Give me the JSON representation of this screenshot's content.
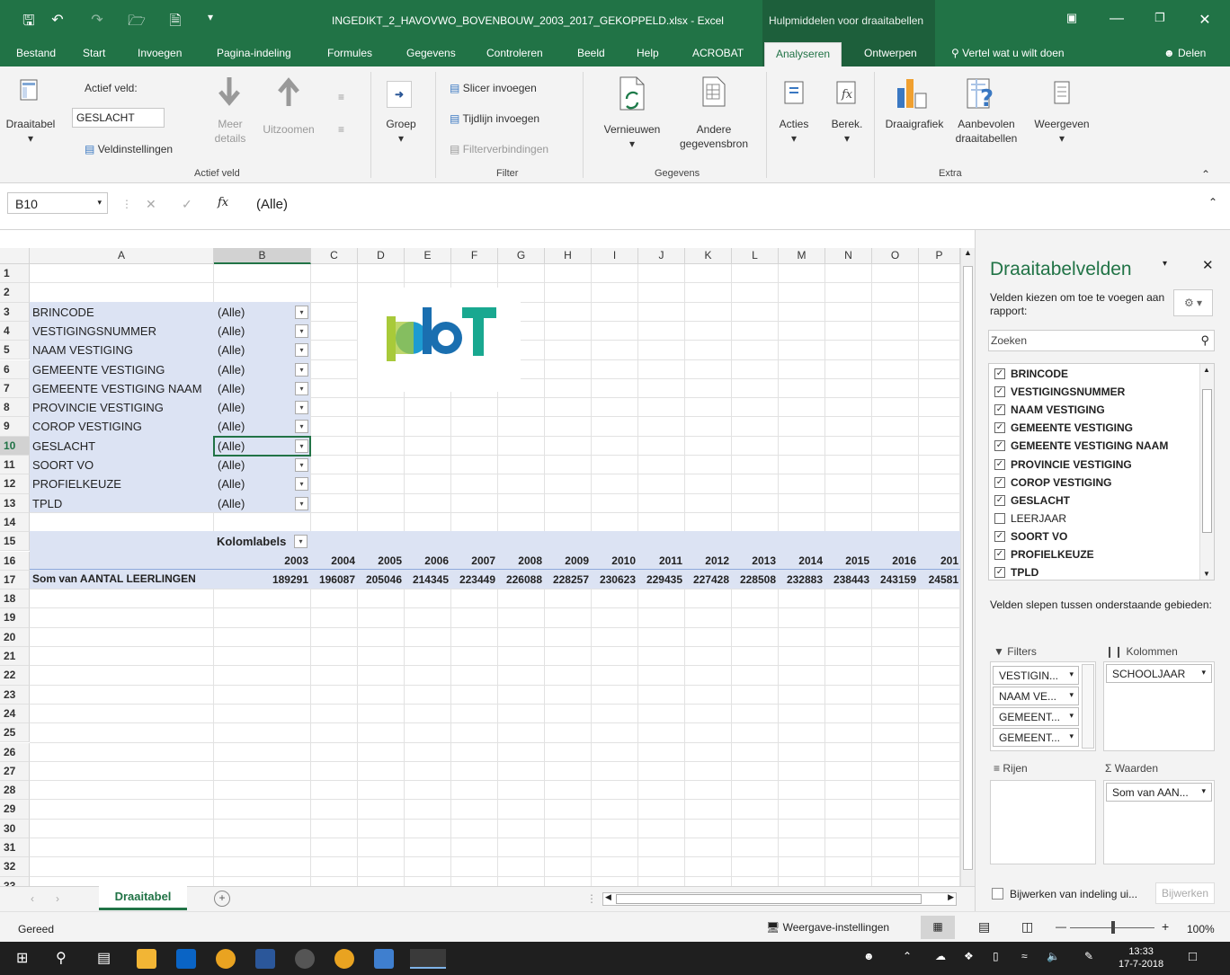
{
  "window": {
    "title": "INGEDIKT_2_HAVOVWO_BOVENBOUW_2003_2017_GEKOPPELD.xlsx  -  Excel",
    "context_title": "Hulpmiddelen voor draaitabellen"
  },
  "menu": {
    "tabs": [
      "Bestand",
      "Start",
      "Invoegen",
      "Pagina-indeling",
      "Formules",
      "Gegevens",
      "Controleren",
      "Beeld",
      "Help",
      "ACROBAT",
      "Analyseren",
      "Ontwerpen"
    ],
    "search": "Vertel wat u wilt doen",
    "share": "Delen"
  },
  "ribbon": {
    "draaitabel": "Draaitabel",
    "actief_veld_label": "Actief veld:",
    "actief_veld_value": "GESLACHT",
    "veldinstellingen": "Veldinstellingen",
    "meer_details": "Meer details",
    "uitzoomen": "Uitzoomen",
    "group_actief_veld": "Actief veld",
    "groep": "Groep",
    "slicer": "Slicer invoegen",
    "tijdlijn": "Tijdlijn invoegen",
    "filterverbindingen": "Filterverbindingen",
    "group_filter": "Filter",
    "vernieuwen": "Vernieuwen",
    "andere": "Andere gegevensbron",
    "group_gegevens": "Gegevens",
    "acties": "Acties",
    "berek": "Berek.",
    "draaigrafiek": "Draaigrafiek",
    "aanbevolen": "Aanbevolen draaitabellen",
    "weergeven": "Weergeven",
    "group_extra": "Extra"
  },
  "formula_bar": {
    "cell_ref": "B10",
    "value": "(Alle)"
  },
  "grid": {
    "columns": [
      "A",
      "B",
      "C",
      "D",
      "E",
      "F",
      "G",
      "H",
      "I",
      "J",
      "K",
      "L",
      "M",
      "N",
      "O",
      "P"
    ],
    "filters": [
      {
        "label": "BRINCODE",
        "value": "(Alle)"
      },
      {
        "label": "VESTIGINGSNUMMER",
        "value": "(Alle)"
      },
      {
        "label": "NAAM VESTIGING",
        "value": "(Alle)"
      },
      {
        "label": "GEMEENTE VESTIGING",
        "value": "(Alle)"
      },
      {
        "label": "GEMEENTE VESTIGING NAAM",
        "value": "(Alle)"
      },
      {
        "label": "PROVINCIE VESTIGING",
        "value": "(Alle)"
      },
      {
        "label": "COROP VESTIGING",
        "value": "(Alle)"
      },
      {
        "label": "GESLACHT",
        "value": "(Alle)"
      },
      {
        "label": "SOORT VO",
        "value": "(Alle)"
      },
      {
        "label": "PROFIELKEUZE",
        "value": "(Alle)"
      },
      {
        "label": "TPLD",
        "value": "(Alle)"
      }
    ],
    "kolomlabels": "Kolomlabels",
    "years": [
      "2003",
      "2004",
      "2005",
      "2006",
      "2007",
      "2008",
      "2009",
      "2010",
      "2011",
      "2012",
      "2013",
      "2014",
      "2015",
      "2016",
      "201"
    ],
    "sum_label": "Som van AANTAL LEERLINGEN",
    "sum_values": [
      "189291",
      "196087",
      "205046",
      "214345",
      "223449",
      "226088",
      "228257",
      "230623",
      "229435",
      "227428",
      "228508",
      "232883",
      "238443",
      "243159",
      "24581"
    ]
  },
  "logo_text": "PbT",
  "pane": {
    "title": "Draaitabelvelden",
    "subtitle": "Velden kiezen om toe te voegen aan rapport:",
    "search_placeholder": "Zoeken",
    "fields": [
      {
        "name": "BRINCODE",
        "checked": true
      },
      {
        "name": "VESTIGINGSNUMMER",
        "checked": true
      },
      {
        "name": "NAAM VESTIGING",
        "checked": true
      },
      {
        "name": "GEMEENTE VESTIGING",
        "checked": true
      },
      {
        "name": "GEMEENTE VESTIGING NAAM",
        "checked": true
      },
      {
        "name": "PROVINCIE VESTIGING",
        "checked": true
      },
      {
        "name": "COROP VESTIGING",
        "checked": true
      },
      {
        "name": "GESLACHT",
        "checked": true
      },
      {
        "name": "LEERJAAR",
        "checked": false
      },
      {
        "name": "SOORT VO",
        "checked": true
      },
      {
        "name": "PROFIELKEUZE",
        "checked": true
      },
      {
        "name": "TPLD",
        "checked": true
      }
    ],
    "drag_text": "Velden slepen tussen onderstaande gebieden:",
    "filters_label": "Filters",
    "kolommen_label": "Kolommen",
    "rijen_label": "Rijen",
    "waarden_label": "Waarden",
    "filter_items": [
      "VESTIGIN...",
      "NAAM VE...",
      "GEMEENT...",
      "GEMEENT..."
    ],
    "kolommen_items": [
      "SCHOOLJAAR"
    ],
    "waarden_items": [
      "Som van AAN..."
    ],
    "defer_label": "Bijwerken van indeling ui...",
    "update_button": "Bijwerken"
  },
  "sheet_tab": "Draaitabel",
  "status": {
    "ready": "Gereed",
    "display_settings": "Weergave-instellingen",
    "zoom": "100%"
  },
  "clock": {
    "time": "13:33",
    "date": "17-7-2018"
  }
}
